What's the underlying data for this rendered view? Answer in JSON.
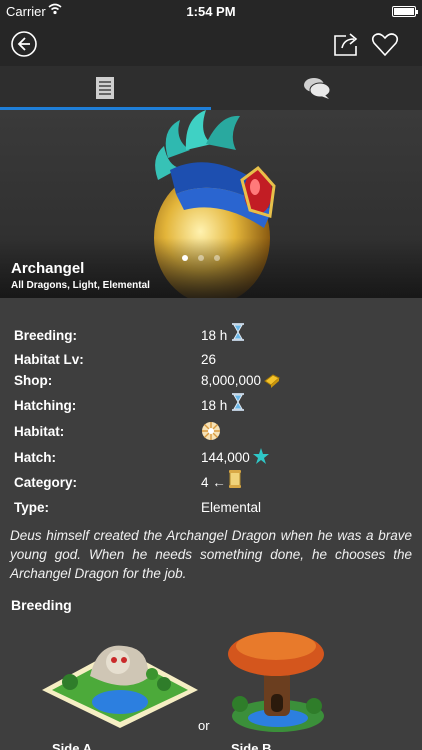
{
  "status_bar": {
    "carrier": "Carrier",
    "time": "1:54 PM"
  },
  "dragon": {
    "name": "Archangel",
    "categories": "All Dragons, Light, Elemental",
    "carousel": {
      "pages": 3,
      "current": 1
    }
  },
  "properties": [
    {
      "label": "Breeding:",
      "value": "18 h",
      "icon": "hourglass-icon"
    },
    {
      "label": "Habitat Lv:",
      "value": "26",
      "icon": ""
    },
    {
      "label": "Shop:",
      "value": "8,000,000",
      "icon": "gold-icon"
    },
    {
      "label": "Hatching:",
      "value": "18 h",
      "icon": "hourglass-icon"
    },
    {
      "label": "Habitat:",
      "value": "",
      "icon": "light-habitat-icon"
    },
    {
      "label": "Hatch:",
      "value": "144,000",
      "icon": "star-icon"
    },
    {
      "label": "Category:",
      "value": "4 ←",
      "icon": "scroll-icon"
    },
    {
      "label": "Type:",
      "value": "Elemental",
      "icon": ""
    }
  ],
  "description": "Deus himself created the Archangel Dragon when he was a brave young god. When he needs something done, he chooses the Archangel Dragon for the job.",
  "breeding": {
    "title": "Breeding",
    "or_label": "or",
    "side_a": "Side A",
    "side_b": "Side B"
  },
  "colors": {
    "accent": "#1f7fd8",
    "background": "#3e3e3e",
    "bar": "#262626"
  }
}
